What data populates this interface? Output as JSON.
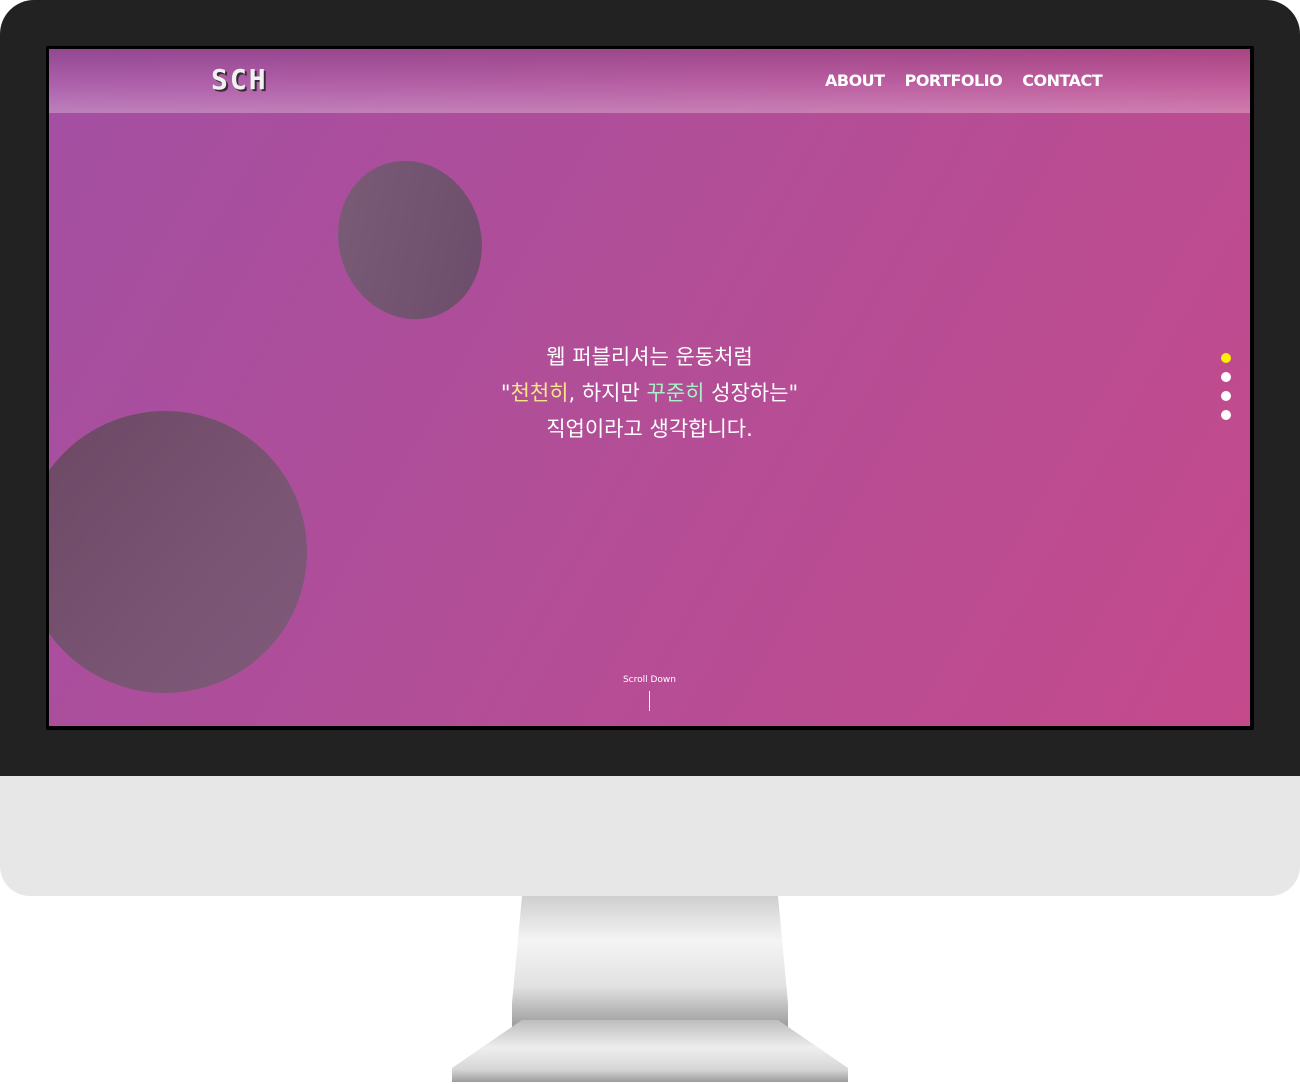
{
  "header": {
    "logo": "SCH",
    "nav": [
      "ABOUT",
      "PORTFOLIO",
      "CONTACT"
    ]
  },
  "intro": {
    "line1": "웹 퍼블리셔는 운동처럼",
    "line2_open_quote": "\"",
    "line2_highlight1": "천천히",
    "line2_mid": ", 하지만 ",
    "line2_highlight2": "꾸준히",
    "line2_end": " 성장하는\"",
    "line3": "직업이라고 생각합니다."
  },
  "scroll": {
    "label": "Scroll Down"
  },
  "pagination": {
    "count": 4,
    "active_index": 0
  },
  "colors": {
    "background_start": "#a34fa2",
    "background_end": "#c44a8c",
    "highlight_yellow": "#f6e58a",
    "highlight_green": "#a8f0c6",
    "active_dot": "#fff000"
  }
}
